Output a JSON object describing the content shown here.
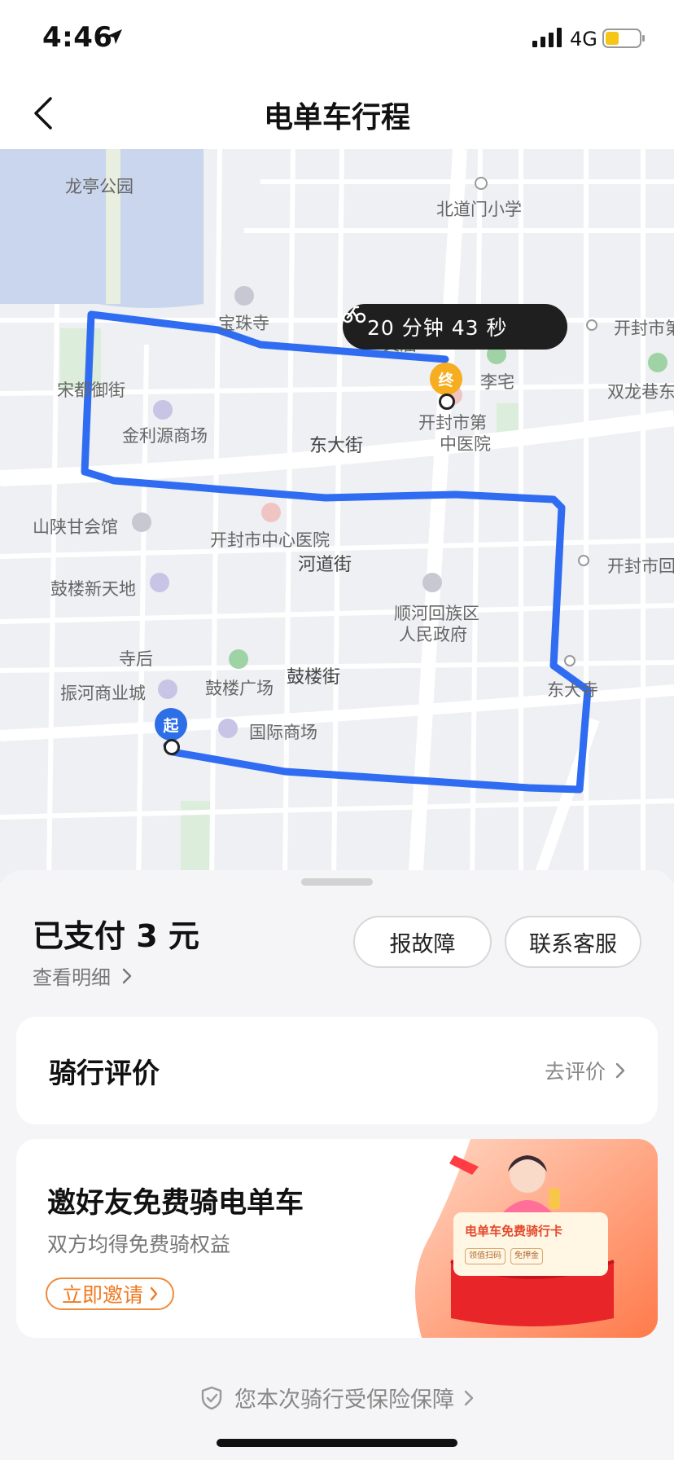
{
  "status_bar": {
    "time": "4:46",
    "network": "4G"
  },
  "nav": {
    "title": "电单车行程"
  },
  "map": {
    "duration": "20 分钟 43 秒",
    "end_pin": "终",
    "start_pin": "起",
    "labels": {
      "longting_park": "龙亭公园",
      "beidaomen_school": "北道门小学",
      "baozhu_temple": "宝珠寺",
      "wenmiao": "文庙",
      "lizhai": "李宅",
      "kaifeng_top_right": "开封市第",
      "songdu_street": "宋都御街",
      "jinliyuan_mall": "金利源商场",
      "kaifeng_hospital_partial": "开封市第",
      "shuanglong_alley": "双龙巷东",
      "shaanxi_guild": "山陕甘会馆",
      "kaifeng_central_hospital": "开封市中心医院",
      "hedao_street": "河道街",
      "gulou_xintiandi": "鼓楼新天地",
      "shunhe_gov_line1": "顺河回族区",
      "shunhe_gov_line2": "人民政府",
      "kaifeng_hui": "开封市回",
      "sihou": "寺后",
      "zhenhe_mall": "振河商业城",
      "gulou_square": "鼓楼广场",
      "guoji_mall": "国际商场",
      "dongda_street": "东大街",
      "zhongyiyuan": "中医院",
      "gulou_street": "鼓楼街",
      "dongda_temple": "东大寺"
    }
  },
  "payment": {
    "paid": "已支付 3 元",
    "detail_link": "查看明细",
    "report_button": "报故障",
    "service_button": "联系客服"
  },
  "rating": {
    "title": "骑行评价",
    "link": "去评价"
  },
  "invite": {
    "title": "邀好友免费骑电单车",
    "subtitle": "双方均得免费骑权益",
    "button": "立即邀请",
    "card_title": "电单车免费骑行卡",
    "card_tag1": "领值扫码",
    "card_tag2": "免押金"
  },
  "insurance": {
    "text": "您本次骑行受保险保障"
  },
  "colors": {
    "route": "#2f6cf2",
    "accent": "#f07a22",
    "end_pin": "#f6ad1f",
    "start_pin": "#2c6fe6"
  }
}
